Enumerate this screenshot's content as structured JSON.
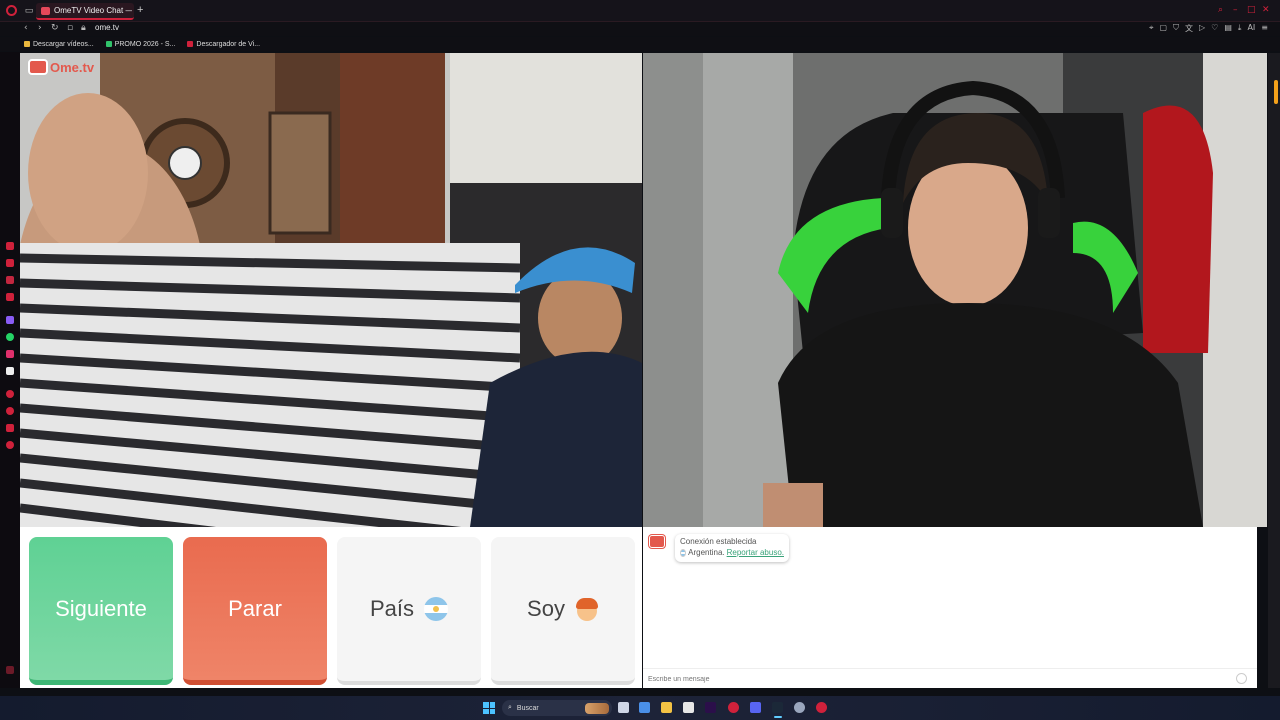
{
  "browser": {
    "tab_title": "OmeTV Video Chat — C",
    "new_tab": "+",
    "url": "ome.tv",
    "ai_label": "AI"
  },
  "bookmarks": [
    {
      "label": "Descargar vídeos...",
      "color": "#e9b73d"
    },
    {
      "label": "PROMO 2026 - S...",
      "color": "#31c36b"
    },
    {
      "label": "Descargador de Vi...",
      "color": "#d0213b"
    }
  ],
  "ometv": {
    "logo_text": "Ome.tv"
  },
  "controls": {
    "next_label": "Siguiente",
    "stop_label": "Parar",
    "country_label": "País",
    "soy_label": "Soy"
  },
  "chat": {
    "status": "Conexión establecida",
    "country": "Argentina.",
    "report": "Reportar abuso.",
    "placeholder": "Escribe un mensaje"
  },
  "taskbar": {
    "search_label": "Buscar"
  },
  "colors": {
    "next": "#5fd194",
    "stop": "#e96b4f",
    "brand": "#e3594d",
    "opera": "#d0213b"
  }
}
